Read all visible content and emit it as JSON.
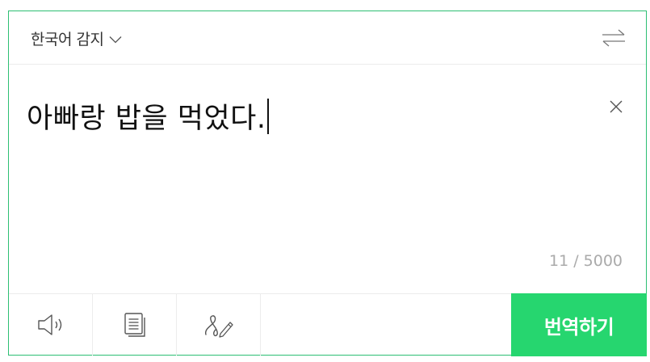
{
  "header": {
    "source_language": "한국어 감지",
    "icons": {
      "dropdown": "chevron-down-icon",
      "swap": "swap-arrows-icon"
    }
  },
  "input": {
    "text": "아빠랑 밥을 먹었다.",
    "counter": "11 / 5000",
    "icons": {
      "clear": "close-icon"
    }
  },
  "toolbar": {
    "tools": [
      {
        "icon": "speaker-icon",
        "purpose": "listen"
      },
      {
        "icon": "document-icon",
        "purpose": "text"
      },
      {
        "icon": "handwriting-icon",
        "purpose": "handwriting"
      }
    ],
    "translate_label": "번역하기"
  },
  "colors": {
    "accent": "#26d66f",
    "border": "#2dbf73",
    "counter_text": "#aaaaaa"
  }
}
